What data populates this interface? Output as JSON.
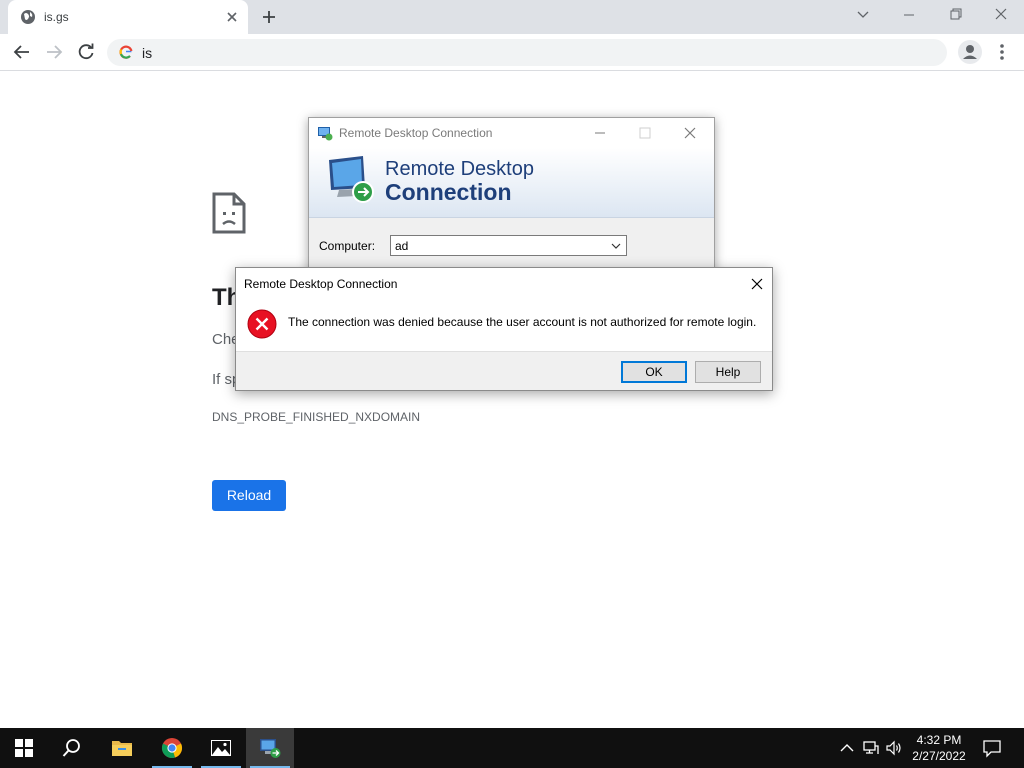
{
  "browser": {
    "tab": {
      "title": "is.gs"
    },
    "omnibox": {
      "text": "is"
    }
  },
  "error_page": {
    "heading": "Th",
    "line1": "Che",
    "line2": "If sp",
    "code": "DNS_PROBE_FINISHED_NXDOMAIN",
    "reload_label": "Reload"
  },
  "rdc_window": {
    "title": "Remote Desktop Connection",
    "banner_line1": "Remote Desktop",
    "banner_line2": "Connection",
    "computer_label": "Computer:",
    "computer_value": "ad"
  },
  "error_dialog": {
    "title": "Remote Desktop Connection",
    "message": "The connection was denied because the user account is not authorized for remote login.",
    "ok_label": "OK",
    "help_label": "Help"
  },
  "taskbar": {
    "items": [
      {
        "name": "start",
        "icon": "windows-logo-icon"
      },
      {
        "name": "search",
        "icon": "search-icon"
      },
      {
        "name": "file-explorer",
        "icon": "folder-icon"
      },
      {
        "name": "chrome",
        "icon": "chrome-icon"
      },
      {
        "name": "photos",
        "icon": "image-icon"
      },
      {
        "name": "remote-desktop",
        "icon": "remote-desktop-icon"
      }
    ],
    "time": "4:32 PM",
    "date": "2/27/2022"
  },
  "colors": {
    "accent_blue": "#1a73e8",
    "dialog_focus": "#0078d7",
    "error_red": "#e81123",
    "taskbar": "#101010"
  }
}
